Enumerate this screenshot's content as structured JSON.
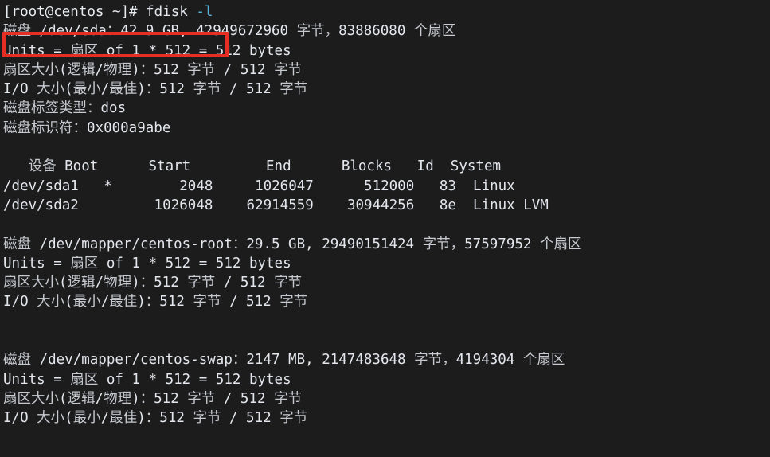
{
  "terminal": {
    "background_color": "#1c1c1c",
    "foreground_color": "#dfe2e8",
    "cjk_color": "#c6c9cf",
    "accent_color": "#58b5d8",
    "highlight_color": "#e62e24",
    "prompt": {
      "user_host": "[root@centos ~]#",
      "command": "fdisk",
      "flag": "-l"
    },
    "lines": [
      {
        "id": "sda-header",
        "segments": [
          {
            "type": "cjk",
            "text": "磁盘"
          },
          {
            "type": "ascii",
            "text": " /dev/sda"
          },
          {
            "type": "cjk",
            "text": "："
          },
          {
            "type": "ascii",
            "text": "42.9 GB, 42949672960 "
          },
          {
            "type": "cjk",
            "text": "字节，"
          },
          {
            "type": "ascii",
            "text": "83886080 "
          },
          {
            "type": "cjk",
            "text": "个扇区"
          }
        ]
      },
      {
        "id": "sda-units",
        "segments": [
          {
            "type": "ascii",
            "text": "Units = "
          },
          {
            "type": "cjk",
            "text": "扇区"
          },
          {
            "type": "ascii",
            "text": " of 1 * 512 = 512 bytes"
          }
        ]
      },
      {
        "id": "sda-sector-size",
        "segments": [
          {
            "type": "cjk",
            "text": "扇区大小"
          },
          {
            "type": "ascii",
            "text": "("
          },
          {
            "type": "cjk",
            "text": "逻辑"
          },
          {
            "type": "ascii",
            "text": "/"
          },
          {
            "type": "cjk",
            "text": "物理"
          },
          {
            "type": "ascii",
            "text": ")"
          },
          {
            "type": "cjk",
            "text": "："
          },
          {
            "type": "ascii",
            "text": "512 "
          },
          {
            "type": "cjk",
            "text": "字节"
          },
          {
            "type": "ascii",
            "text": " / 512 "
          },
          {
            "type": "cjk",
            "text": "字节"
          }
        ]
      },
      {
        "id": "sda-io-size",
        "segments": [
          {
            "type": "ascii",
            "text": "I/O "
          },
          {
            "type": "cjk",
            "text": "大小"
          },
          {
            "type": "ascii",
            "text": "("
          },
          {
            "type": "cjk",
            "text": "最小"
          },
          {
            "type": "ascii",
            "text": "/"
          },
          {
            "type": "cjk",
            "text": "最佳"
          },
          {
            "type": "ascii",
            "text": ")"
          },
          {
            "type": "cjk",
            "text": "："
          },
          {
            "type": "ascii",
            "text": "512 "
          },
          {
            "type": "cjk",
            "text": "字节"
          },
          {
            "type": "ascii",
            "text": " / 512 "
          },
          {
            "type": "cjk",
            "text": "字节"
          }
        ]
      },
      {
        "id": "sda-label-type",
        "segments": [
          {
            "type": "cjk",
            "text": "磁盘标签类型："
          },
          {
            "type": "ascii",
            "text": "dos"
          }
        ]
      },
      {
        "id": "sda-identifier",
        "segments": [
          {
            "type": "cjk",
            "text": "磁盘标识符："
          },
          {
            "type": "ascii",
            "text": "0x000a9abe"
          }
        ]
      },
      {
        "id": "blank-1",
        "segments": [
          {
            "type": "ascii",
            "text": " "
          }
        ]
      },
      {
        "id": "partition-table-header",
        "segments": [
          {
            "type": "ascii",
            "text": "   "
          },
          {
            "type": "cjk",
            "text": "设备"
          },
          {
            "type": "ascii",
            "text": " Boot      Start         End      Blocks   Id  System"
          }
        ]
      },
      {
        "id": "partition-row-sda1",
        "segments": [
          {
            "type": "ascii",
            "text": "/dev/sda1   *        2048     1026047      512000   83  Linux"
          }
        ]
      },
      {
        "id": "partition-row-sda2",
        "segments": [
          {
            "type": "ascii",
            "text": "/dev/sda2         1026048    62914559    30944256   8e  Linux LVM"
          }
        ]
      },
      {
        "id": "blank-2",
        "segments": [
          {
            "type": "ascii",
            "text": " "
          }
        ]
      },
      {
        "id": "root-header",
        "segments": [
          {
            "type": "cjk",
            "text": "磁盘"
          },
          {
            "type": "ascii",
            "text": " /dev/mapper/centos-root"
          },
          {
            "type": "cjk",
            "text": "："
          },
          {
            "type": "ascii",
            "text": "29.5 GB, 29490151424 "
          },
          {
            "type": "cjk",
            "text": "字节，"
          },
          {
            "type": "ascii",
            "text": "57597952 "
          },
          {
            "type": "cjk",
            "text": "个扇区"
          }
        ]
      },
      {
        "id": "root-units",
        "segments": [
          {
            "type": "ascii",
            "text": "Units = "
          },
          {
            "type": "cjk",
            "text": "扇区"
          },
          {
            "type": "ascii",
            "text": " of 1 * 512 = 512 bytes"
          }
        ]
      },
      {
        "id": "root-sector-size",
        "segments": [
          {
            "type": "cjk",
            "text": "扇区大小"
          },
          {
            "type": "ascii",
            "text": "("
          },
          {
            "type": "cjk",
            "text": "逻辑"
          },
          {
            "type": "ascii",
            "text": "/"
          },
          {
            "type": "cjk",
            "text": "物理"
          },
          {
            "type": "ascii",
            "text": ")"
          },
          {
            "type": "cjk",
            "text": "："
          },
          {
            "type": "ascii",
            "text": "512 "
          },
          {
            "type": "cjk",
            "text": "字节"
          },
          {
            "type": "ascii",
            "text": " / 512 "
          },
          {
            "type": "cjk",
            "text": "字节"
          }
        ]
      },
      {
        "id": "root-io-size",
        "segments": [
          {
            "type": "ascii",
            "text": "I/O "
          },
          {
            "type": "cjk",
            "text": "大小"
          },
          {
            "type": "ascii",
            "text": "("
          },
          {
            "type": "cjk",
            "text": "最小"
          },
          {
            "type": "ascii",
            "text": "/"
          },
          {
            "type": "cjk",
            "text": "最佳"
          },
          {
            "type": "ascii",
            "text": ")"
          },
          {
            "type": "cjk",
            "text": "："
          },
          {
            "type": "ascii",
            "text": "512 "
          },
          {
            "type": "cjk",
            "text": "字节"
          },
          {
            "type": "ascii",
            "text": " / 512 "
          },
          {
            "type": "cjk",
            "text": "字节"
          }
        ]
      },
      {
        "id": "blank-3",
        "segments": [
          {
            "type": "ascii",
            "text": " "
          }
        ]
      },
      {
        "id": "blank-4",
        "segments": [
          {
            "type": "ascii",
            "text": " "
          }
        ]
      },
      {
        "id": "swap-header",
        "segments": [
          {
            "type": "cjk",
            "text": "磁盘"
          },
          {
            "type": "ascii",
            "text": " /dev/mapper/centos-swap"
          },
          {
            "type": "cjk",
            "text": "："
          },
          {
            "type": "ascii",
            "text": "2147 MB, 2147483648 "
          },
          {
            "type": "cjk",
            "text": "字节，"
          },
          {
            "type": "ascii",
            "text": "4194304 "
          },
          {
            "type": "cjk",
            "text": "个扇区"
          }
        ]
      },
      {
        "id": "swap-units",
        "segments": [
          {
            "type": "ascii",
            "text": "Units = "
          },
          {
            "type": "cjk",
            "text": "扇区"
          },
          {
            "type": "ascii",
            "text": " of 1 * 512 = 512 bytes"
          }
        ]
      },
      {
        "id": "swap-sector-size",
        "segments": [
          {
            "type": "cjk",
            "text": "扇区大小"
          },
          {
            "type": "ascii",
            "text": "("
          },
          {
            "type": "cjk",
            "text": "逻辑"
          },
          {
            "type": "ascii",
            "text": "/"
          },
          {
            "type": "cjk",
            "text": "物理"
          },
          {
            "type": "ascii",
            "text": ")"
          },
          {
            "type": "cjk",
            "text": "："
          },
          {
            "type": "ascii",
            "text": "512 "
          },
          {
            "type": "cjk",
            "text": "字节"
          },
          {
            "type": "ascii",
            "text": " / 512 "
          },
          {
            "type": "cjk",
            "text": "字节"
          }
        ]
      },
      {
        "id": "swap-io-size",
        "segments": [
          {
            "type": "ascii",
            "text": "I/O "
          },
          {
            "type": "cjk",
            "text": "大小"
          },
          {
            "type": "ascii",
            "text": "("
          },
          {
            "type": "cjk",
            "text": "最小"
          },
          {
            "type": "ascii",
            "text": "/"
          },
          {
            "type": "cjk",
            "text": "最佳"
          },
          {
            "type": "ascii",
            "text": ")"
          },
          {
            "type": "cjk",
            "text": "："
          },
          {
            "type": "ascii",
            "text": "512 "
          },
          {
            "type": "cjk",
            "text": "字节"
          },
          {
            "type": "ascii",
            "text": " / 512 "
          },
          {
            "type": "cjk",
            "text": "字节"
          }
        ]
      }
    ],
    "annotation": {
      "kind": "red-rectangle-highlight",
      "target_text": "磁盘 /dev/sda：42.9 GB,"
    },
    "partition_table": {
      "columns": [
        "设备",
        "Boot",
        "Start",
        "End",
        "Blocks",
        "Id",
        "System"
      ],
      "rows": [
        {
          "device": "/dev/sda1",
          "boot": "*",
          "start": "2048",
          "end": "1026047",
          "blocks": "512000",
          "id": "83",
          "system": "Linux"
        },
        {
          "device": "/dev/sda2",
          "boot": "",
          "start": "1026048",
          "end": "62914559",
          "blocks": "30944256",
          "id": "8e",
          "system": "Linux LVM"
        }
      ]
    },
    "disks": [
      {
        "name": "/dev/sda",
        "size_human": "42.9 GB",
        "size_bytes": "42949672960",
        "sectors": "83886080",
        "units": "512",
        "sector_size_logical": "512",
        "sector_size_physical": "512",
        "io_size_min": "512",
        "io_size_optimal": "512",
        "label_type": "dos",
        "identifier": "0x000a9abe"
      },
      {
        "name": "/dev/mapper/centos-root",
        "size_human": "29.5 GB",
        "size_bytes": "29490151424",
        "sectors": "57597952",
        "units": "512",
        "sector_size_logical": "512",
        "sector_size_physical": "512",
        "io_size_min": "512",
        "io_size_optimal": "512"
      },
      {
        "name": "/dev/mapper/centos-swap",
        "size_human": "2147 MB",
        "size_bytes": "2147483648",
        "sectors": "4194304",
        "units": "512",
        "sector_size_logical": "512",
        "sector_size_physical": "512",
        "io_size_min": "512",
        "io_size_optimal": "512"
      }
    ]
  }
}
